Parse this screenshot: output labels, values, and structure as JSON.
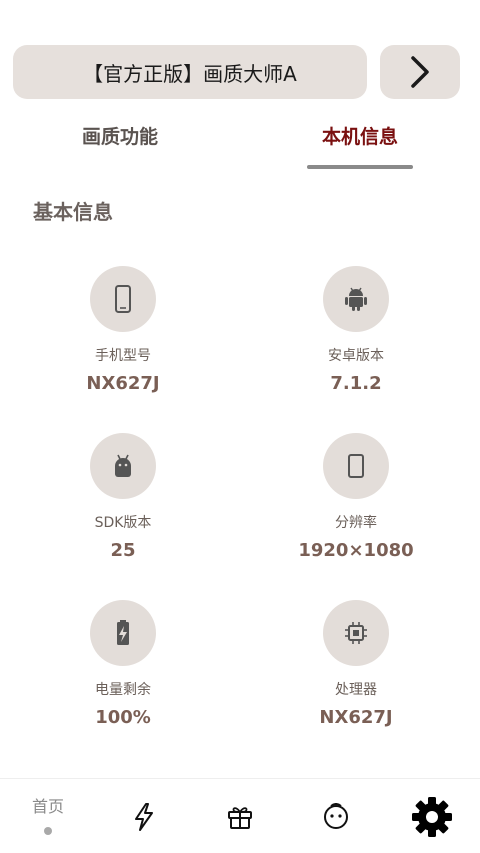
{
  "header": {
    "title": "【官方正版】画质大师A",
    "next_icon": "chevron-right-icon"
  },
  "tabs": [
    {
      "label": "画质功能",
      "active": false
    },
    {
      "label": "本机信息",
      "active": true
    }
  ],
  "section": {
    "title": "基本信息"
  },
  "info_items": [
    {
      "icon": "phone-icon",
      "label": "手机型号",
      "value": "NX627J"
    },
    {
      "icon": "android-icon",
      "label": "安卓版本",
      "value": "7.1.2"
    },
    {
      "icon": "android-head-icon",
      "label": "SDK版本",
      "value": "25"
    },
    {
      "icon": "screen-icon",
      "label": "分辨率",
      "value": "1920×1080"
    },
    {
      "icon": "battery-charging-icon",
      "label": "电量剩余",
      "value": "100%"
    },
    {
      "icon": "cpu-icon",
      "label": "处理器",
      "value": "NX627J"
    }
  ],
  "bottom_nav": {
    "home_label": "首页",
    "items": [
      "home",
      "lightning-icon",
      "gift-icon",
      "smiley-icon",
      "gear-icon"
    ]
  },
  "colors": {
    "pill_bg": "#e6e0dc",
    "active_tab": "#7a1010",
    "value_text": "#7a5f55"
  }
}
